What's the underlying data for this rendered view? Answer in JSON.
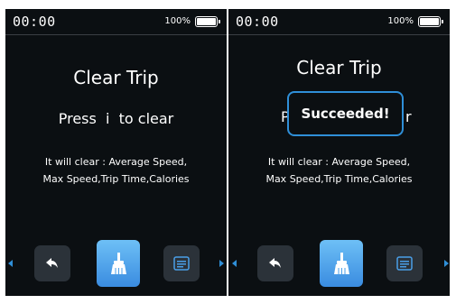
{
  "screens": [
    {
      "status": {
        "time": "00:00",
        "battery": "100%"
      },
      "title": "Clear Trip",
      "press_text": "Press  i  to clear",
      "info_lines": [
        "It will clear : Average Speed,",
        "Max Speed,Trip Time,Calories"
      ],
      "buttons": {
        "back": "back-icon",
        "clear": "broom-icon",
        "menu": "menu-icon"
      }
    },
    {
      "status": {
        "time": "00:00",
        "battery": "100%"
      },
      "title": "Clear Trip",
      "press_text_left": "P",
      "press_text_right": "r",
      "toast": "Succeeded!",
      "info_lines": [
        "It will clear : Average Speed,",
        "Max Speed,Trip Time,Calories"
      ],
      "buttons": {
        "back": "back-icon",
        "clear": "broom-icon",
        "menu": "menu-icon"
      }
    }
  ],
  "colors": {
    "screen_bg": "#0b0f12",
    "accent": "#2f8fd8",
    "button_bg": "#2b3239",
    "clear_button": "#4a9fe8"
  }
}
